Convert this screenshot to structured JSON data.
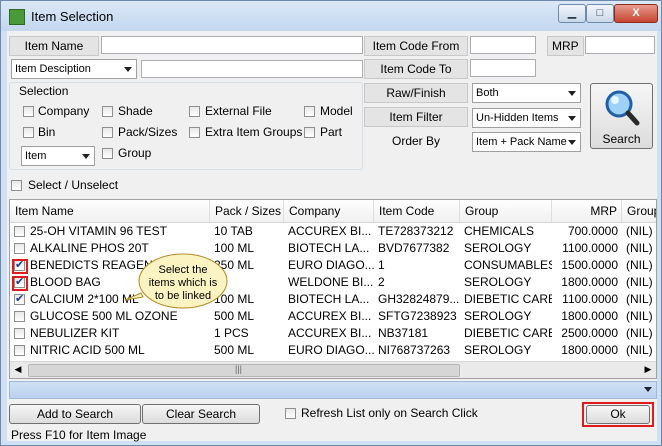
{
  "window": {
    "title": "Item Selection",
    "minimize_glyph": "▁",
    "maximize_glyph": "□",
    "close_glyph": "X"
  },
  "fields": {
    "item_name_label": "Item Name",
    "item_code_from_label": "Item Code From",
    "mrp_label": "MRP",
    "item_description_combo": "Item Desciption",
    "item_code_to_label": "Item Code To",
    "raw_finish_label": "Raw/Finish",
    "raw_finish_value": "Both",
    "item_filter_label": "Item Filter",
    "item_filter_value": "Un-Hidden Items",
    "order_by_label": "Order By",
    "order_by_value": "Item + Pack  Name"
  },
  "selection": {
    "title": "Selection",
    "options": [
      "Company",
      "Shade",
      "External File",
      "Model",
      "Bin",
      "Pack/Sizes",
      "Extra Item Groups",
      "Part",
      "Group"
    ],
    "type_combo": "Item"
  },
  "search_button": "Search",
  "select_unselect": "Select / Unselect",
  "grid": {
    "columns": [
      "Item Name",
      "Pack / Sizes",
      "Company",
      "Item Code",
      "Group",
      "MRP",
      "Group"
    ],
    "rows": [
      {
        "checked": false,
        "name": "25-OH VITAMIN 96 TEST",
        "pack": "10 TAB",
        "company": "ACCUREX BI...",
        "code": "TE728373212",
        "group": "CHEMICALS",
        "mrp": "700.0000",
        "group2": "(NIL)"
      },
      {
        "checked": false,
        "name": "ALKALINE PHOS 20T",
        "pack": "100 ML",
        "company": "BIOTECH LA...",
        "code": "BVD7677382",
        "group": "SEROLOGY",
        "mrp": "1100.0000",
        "group2": "(NIL)"
      },
      {
        "checked": true,
        "name": "BENEDICTS REAGENT",
        "pack": "250 ML",
        "company": "EURO DIAGO...",
        "code": "1",
        "group": "CONSUMABLES",
        "mrp": "1500.0000",
        "group2": "(NIL)"
      },
      {
        "checked": true,
        "name": "BLOOD BAG",
        "pack": "",
        "company": "WELDONE BI...",
        "code": "2",
        "group": "SEROLOGY",
        "mrp": "1800.0000",
        "group2": "(NIL)"
      },
      {
        "checked": true,
        "name": "CALCIUM 2*100 ML",
        "pack": "100 ML",
        "company": "BIOTECH LA...",
        "code": "GH32824879...",
        "group": "DIEBETIC CARE",
        "mrp": "1100.0000",
        "group2": "(NIL)"
      },
      {
        "checked": false,
        "name": "GLUCOSE 500 ML OZONE",
        "pack": "500 ML",
        "company": "ACCUREX BI...",
        "code": "SFTG7238923",
        "group": "SEROLOGY",
        "mrp": "1800.0000",
        "group2": "(NIL)"
      },
      {
        "checked": false,
        "name": "NEBULIZER KIT",
        "pack": "1 PCS",
        "company": "ACCUREX BI...",
        "code": "NB37181",
        "group": "DIEBETIC CARE",
        "mrp": "2500.0000",
        "group2": "(NIL)"
      },
      {
        "checked": false,
        "name": "NITRIC ACID 500 ML",
        "pack": "500 ML",
        "company": "EURO DIAGO...",
        "code": "NI768737263",
        "group": "SEROLOGY",
        "mrp": "1800.0000",
        "group2": "(NIL)"
      }
    ]
  },
  "callout": "Select the items which is to be linked",
  "buttons": {
    "add_to_search": "Add to Search",
    "clear_search": "Clear Search",
    "refresh_only": "Refresh List only on Search Click",
    "ok": "Ok"
  },
  "status_text": "Press F10 for Item Image",
  "colors": {
    "highlight": "#e01b1b",
    "callout_fill": "#fbf3c2"
  }
}
